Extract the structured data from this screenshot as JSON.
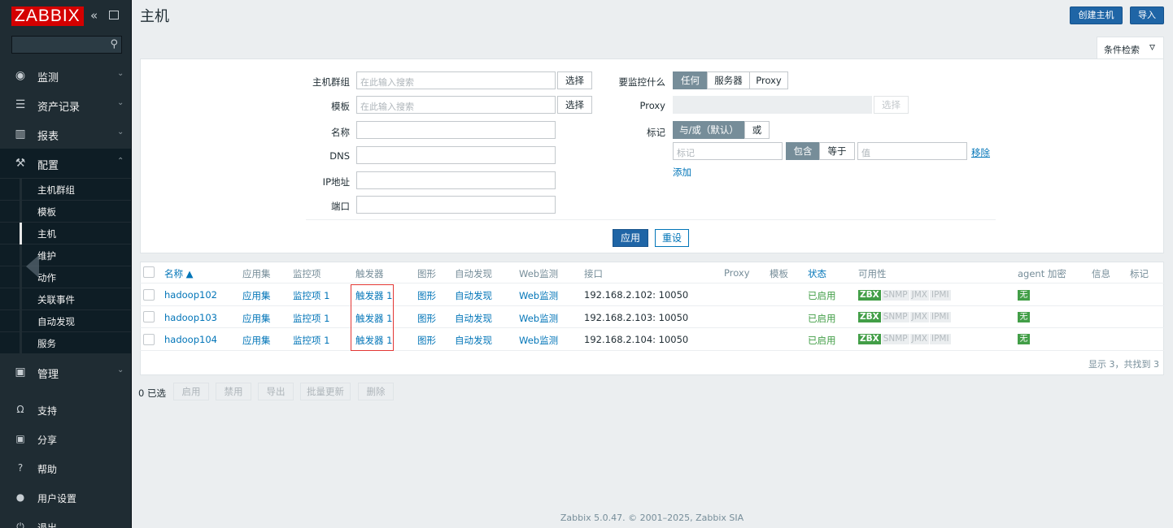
{
  "sidebar": {
    "logo": "ZABBIX",
    "collapse_glyph": "«",
    "menu": [
      {
        "label": "监测",
        "icon": "eye-icon"
      },
      {
        "label": "资产记录",
        "icon": "list-icon"
      },
      {
        "label": "报表",
        "icon": "bar-chart-icon"
      },
      {
        "label": "配置",
        "icon": "wrench-icon"
      },
      {
        "label": "管理",
        "icon": "admin-icon"
      }
    ],
    "config_sub": [
      {
        "label": "主机群组"
      },
      {
        "label": "模板"
      },
      {
        "label": "主机"
      },
      {
        "label": "维护"
      },
      {
        "label": "动作"
      },
      {
        "label": "关联事件"
      },
      {
        "label": "自动发现"
      },
      {
        "label": "服务"
      }
    ],
    "bottom": [
      {
        "label": "支持",
        "icon": "support-icon"
      },
      {
        "label": "分享",
        "icon": "share-icon"
      },
      {
        "label": "帮助",
        "icon": "help-icon"
      },
      {
        "label": "用户设置",
        "icon": "user-icon"
      },
      {
        "label": "退出",
        "icon": "power-icon"
      }
    ]
  },
  "header": {
    "title": "主机",
    "create_label": "创建主机",
    "import_label": "导入"
  },
  "filter": {
    "tab_label": "条件检索",
    "host_groups_label": "主机群组",
    "host_groups_placeholder": "在此输入搜索",
    "templates_label": "模板",
    "templates_placeholder": "在此输入搜索",
    "select_label": "选择",
    "name_label": "名称",
    "dns_label": "DNS",
    "ip_label": "IP地址",
    "port_label": "端口",
    "monitored_by_label": "要监控什么",
    "monitored_by_options": [
      "任何",
      "服务器",
      "Proxy"
    ],
    "proxy_label": "Proxy",
    "tags_label": "标记",
    "tags_eval_options": [
      "与/或（默认）",
      "或"
    ],
    "tag_placeholder": "标记",
    "tag_operator_options": [
      "包含",
      "等于"
    ],
    "value_placeholder": "值",
    "remove_label": "移除",
    "add_label": "添加",
    "apply_label": "应用",
    "reset_label": "重设"
  },
  "table": {
    "headers": {
      "name": "名称 ▲",
      "applications": "应用集",
      "items": "监控项",
      "triggers": "触发器",
      "graphs": "图形",
      "discovery": "自动发现",
      "web": "Web监测",
      "interface": "接口",
      "proxy": "Proxy",
      "templates": "模板",
      "status": "状态",
      "availability": "可用性",
      "agent_encryption": "agent 加密",
      "info": "信息",
      "tags": "标记"
    },
    "rows": [
      {
        "name": "hadoop102",
        "applications": "应用集",
        "items": "监控项 1",
        "triggers": "触发器 1",
        "graphs": "图形",
        "discovery": "自动发现",
        "web": "Web监测",
        "interface": "192.168.2.102: 10050",
        "status": "已启用",
        "avail": [
          "ZBX",
          "SNMP",
          "JMX",
          "IPMI"
        ],
        "encryption": "无"
      },
      {
        "name": "hadoop103",
        "applications": "应用集",
        "items": "监控项 1",
        "triggers": "触发器 1",
        "graphs": "图形",
        "discovery": "自动发现",
        "web": "Web监测",
        "interface": "192.168.2.103: 10050",
        "status": "已启用",
        "avail": [
          "ZBX",
          "SNMP",
          "JMX",
          "IPMI"
        ],
        "encryption": "无"
      },
      {
        "name": "hadoop104",
        "applications": "应用集",
        "items": "监控项 1",
        "triggers": "触发器 1",
        "graphs": "图形",
        "discovery": "自动发现",
        "web": "Web监测",
        "interface": "192.168.2.104: 10050",
        "status": "已启用",
        "avail": [
          "ZBX",
          "SNMP",
          "JMX",
          "IPMI"
        ],
        "encryption": "无"
      }
    ],
    "found_text": "显示 3，共找到 3"
  },
  "bulk": {
    "selected": "0 已选",
    "enable": "启用",
    "disable": "禁用",
    "export": "导出",
    "mass_update": "批量更新",
    "delete": "删除"
  },
  "footer": "Zabbix 5.0.47. © 2001–2025, Zabbix SIA",
  "colors": {
    "sidebar_bg": "#1f2c33",
    "logo_red": "#d40000",
    "primary_blue": "#1f65a6",
    "link_blue": "#0275b8",
    "status_green": "#429e47",
    "highlight_red": "#e33734"
  }
}
